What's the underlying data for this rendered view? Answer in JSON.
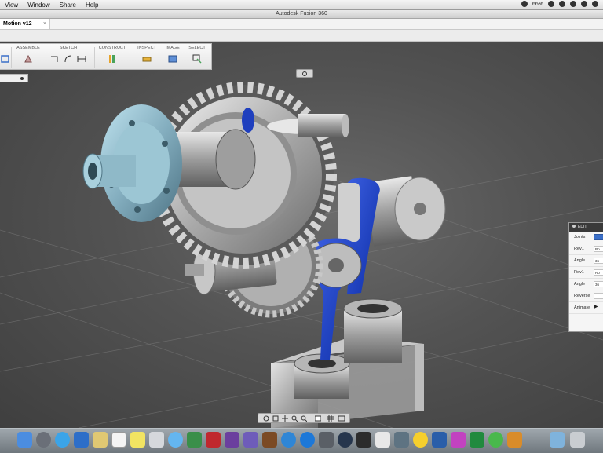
{
  "menubar": {
    "items": [
      "View",
      "Window",
      "Share",
      "Help"
    ],
    "battery": "66%"
  },
  "window": {
    "title": "Autodesk Fusion 360"
  },
  "tab": {
    "label": "Motion v12",
    "close": "×"
  },
  "toolbar": {
    "groups": [
      "ASSEMBLE",
      "SKETCH",
      "CONSTRUCT",
      "INSPECT",
      "IMAGE",
      "SELECT"
    ]
  },
  "edit_panel": {
    "title": "EDIT",
    "rows": [
      {
        "label": "Joints",
        "value": "",
        "highlight": true
      },
      {
        "label": "Rev1",
        "value": "Ro"
      },
      {
        "label": "Angle",
        "value": "36"
      },
      {
        "label": "Rev1",
        "value": "Ro"
      },
      {
        "label": "Angle",
        "value": "36"
      },
      {
        "label": "Reverse",
        "value": ""
      },
      {
        "label": "Animate",
        "value": "▶"
      }
    ]
  },
  "dock": {
    "icons": [
      "finder-icon",
      "launchpad-icon",
      "safari-icon",
      "preview-icon",
      "notes-icon",
      "calendar-icon",
      "stickies-icon",
      "photo-icon",
      "messages-icon",
      "facetime-icon",
      "photobooth-icon",
      "itunes-icon",
      "imovie-icon",
      "guitar-icon",
      "quicktime-icon",
      "appstore-icon",
      "systemprefs-icon",
      "dashboard-icon",
      "activity-icon",
      "automator-icon",
      "messenger-icon",
      "word-icon",
      "excel-icon",
      "fusion-icon",
      "trash-icon"
    ]
  }
}
